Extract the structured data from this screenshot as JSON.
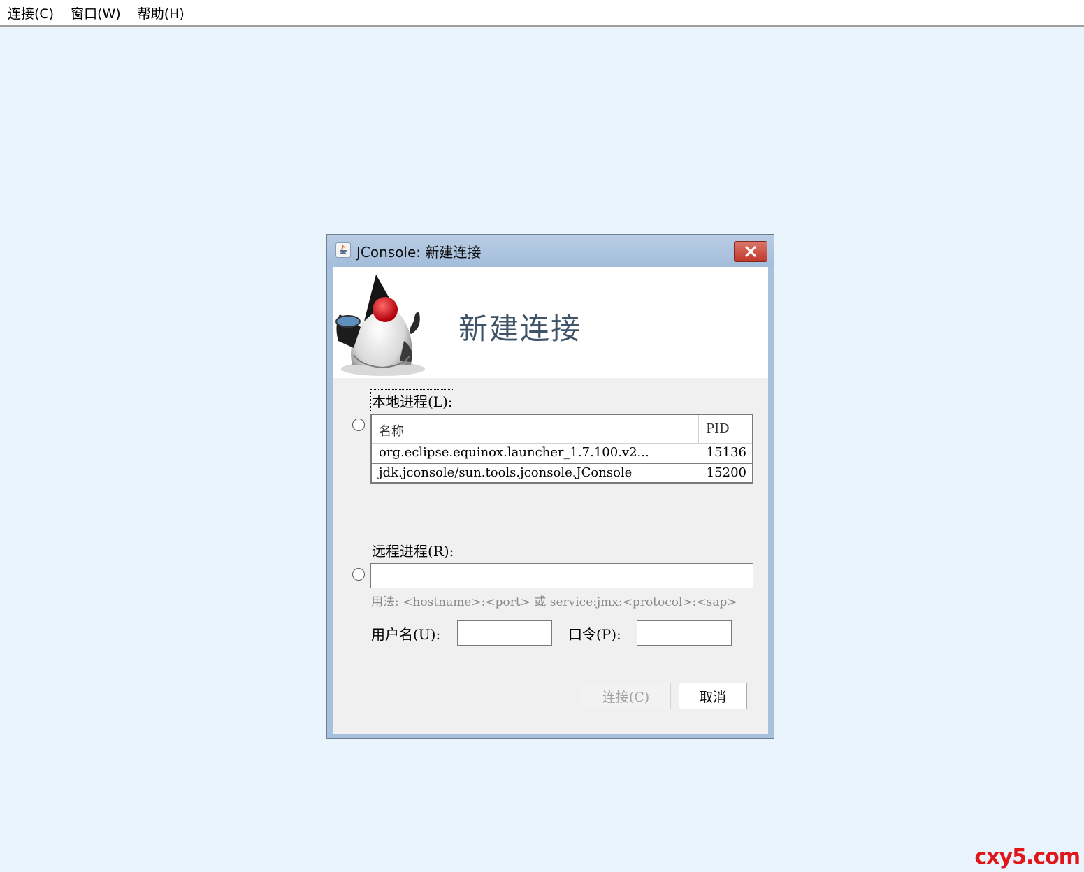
{
  "menubar": {
    "items": [
      {
        "label": "连接(C)"
      },
      {
        "label": "窗口(W)"
      },
      {
        "label": "帮助(H)"
      }
    ]
  },
  "dialog": {
    "title": "JConsole: 新建连接",
    "header_title": "新建连接",
    "local": {
      "label": "本地进程(L):",
      "table": {
        "columns": [
          "名称",
          "PID"
        ],
        "rows": [
          {
            "name": "org.eclipse.equinox.launcher_1.7.100.v2...",
            "pid": "15136"
          },
          {
            "name": "jdk.jconsole/sun.tools.jconsole.JConsole",
            "pid": "15200"
          }
        ]
      }
    },
    "remote": {
      "label": "远程进程(R):",
      "value": "",
      "usage": "用法: <hostname>:<port> 或 service:jmx:<protocol>:<sap>"
    },
    "username": {
      "label": "用户名(U):",
      "value": ""
    },
    "password": {
      "label": "口令(P):",
      "value": ""
    },
    "buttons": {
      "connect": "连接(C)",
      "cancel": "取消"
    }
  },
  "watermark": "cxy5.com",
  "colors": {
    "desktop_bg": "#eaf4fd",
    "title_bar": "#a7c0dc",
    "close_button": "#c2382a",
    "header_title": "#3f5468",
    "watermark": "#e0161b"
  }
}
